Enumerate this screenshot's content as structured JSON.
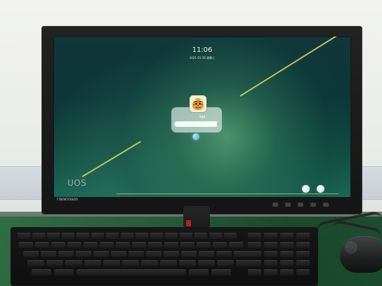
{
  "scene": {
    "monitor_brand": "ThinkVision",
    "screen": {
      "time": "11:06",
      "date": "2021-01-26 星期二",
      "user_name": "ligo",
      "logo": "UOS"
    },
    "icons": {
      "avatar": "tiger-avatar-icon",
      "confirm": "confirm-circle-icon",
      "left_system_button": "system-button-icon",
      "right_system_button": "power-button-icon"
    },
    "colors": {
      "screen_base": "#12363a",
      "screen_glow": "#60aa7d",
      "screen_line": "#c7cc5d",
      "desk_mat": "#2e6d43",
      "monitor_body": "#1b1b1b",
      "keyboard": "#151515",
      "mouse": "#303232"
    }
  }
}
